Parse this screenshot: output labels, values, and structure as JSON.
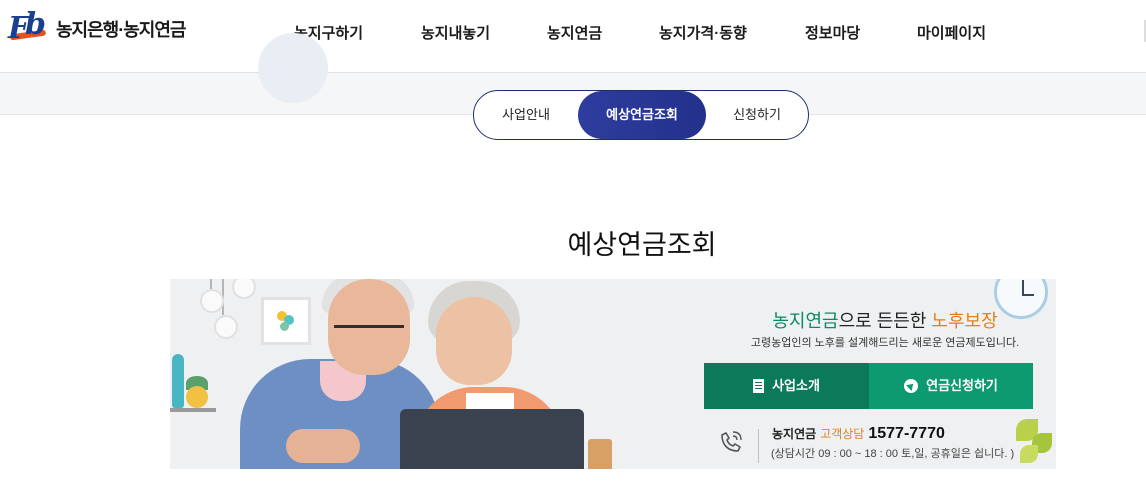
{
  "logo": {
    "mark_f": "F",
    "mark_b": "b",
    "text": "농지은행·농지연금"
  },
  "nav": [
    {
      "label": "농지구하기"
    },
    {
      "label": "농지내놓기"
    },
    {
      "label": "농지연금"
    },
    {
      "label": "농지가격·동향"
    },
    {
      "label": "정보마당"
    },
    {
      "label": "마이페이지"
    }
  ],
  "tabs": [
    {
      "label": "사업안내",
      "active": false
    },
    {
      "label": "예상연금조회",
      "active": true
    },
    {
      "label": "신청하기",
      "active": false
    }
  ],
  "page_title": "예상연금조회",
  "banner": {
    "slogan": {
      "part1": "농지연금",
      "part2": "으로 든든한 ",
      "part3": "노후보장"
    },
    "subtitle": "고령농업인의 노후를 설계해드리는 새로운 연금제도입니다.",
    "buttons": [
      {
        "label": "사업소개",
        "icon": "document-icon"
      },
      {
        "label": "연금신청하기",
        "icon": "cursor-icon"
      }
    ],
    "contact": {
      "name": "농지연금",
      "label": "고객상담",
      "number": "1577-7770",
      "hours": "(상담시간 09 : 00 ~ 18 : 00 토,일, 공휴일은 쉽니다. )"
    }
  },
  "colors": {
    "brand_navy": "#1e2f6e",
    "active_tab": "#2b3a9a",
    "green_dark": "#0a7a5a",
    "green": "#0e9a70",
    "orange": "#e4801a"
  }
}
